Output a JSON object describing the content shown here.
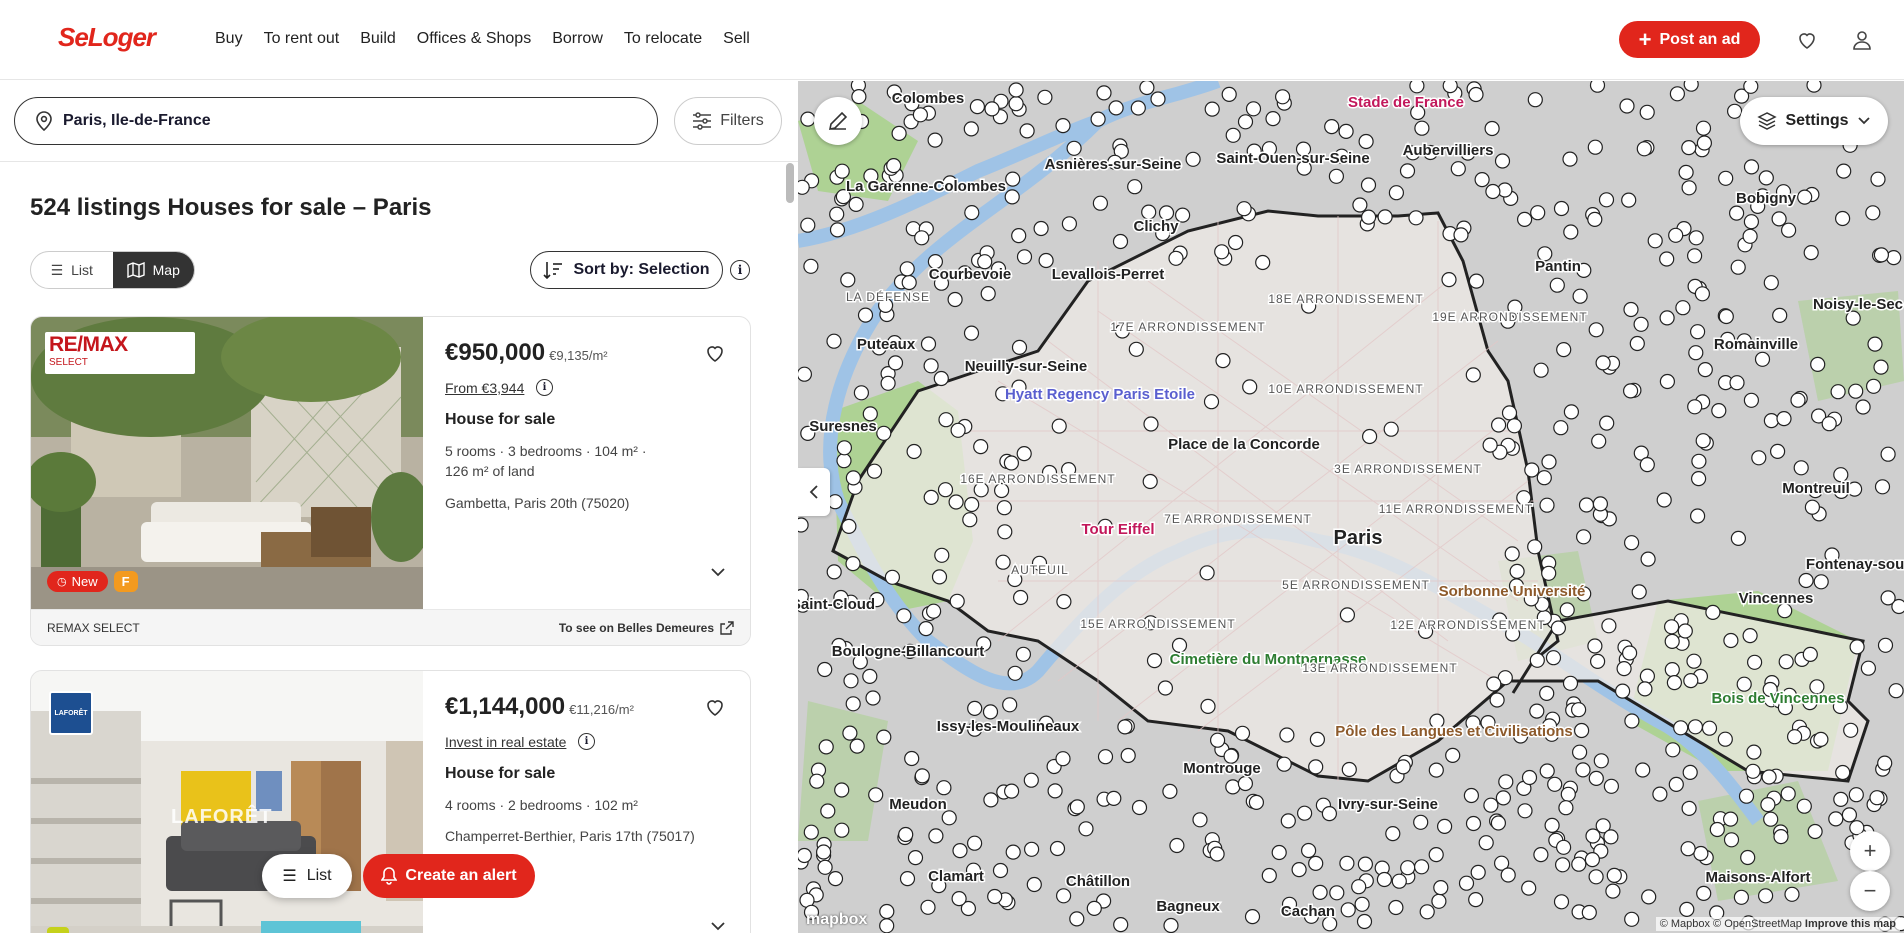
{
  "header": {
    "logo": "SeLoger",
    "nav": [
      "Buy",
      "To rent out",
      "Build",
      "Offices & Shops",
      "Borrow",
      "To relocate",
      "Sell"
    ],
    "post_ad": "Post an ad"
  },
  "search": {
    "location": "Paris, Ile-de-France",
    "filters_label": "Filters"
  },
  "results": {
    "title": "524 listings Houses for sale – Paris",
    "view_list": "List",
    "view_map": "Map",
    "sort_label": "Sort by: Selection"
  },
  "listings": [
    {
      "agency_logo": "RE/MAX",
      "agency_logo_sub": "SELECT",
      "price": "€950,000",
      "price_m2": "€9,135/m²",
      "link": "From €3,944",
      "type": "House for sale",
      "specs_line1": "5 rooms · 3 bedrooms · 104 m² ·",
      "specs_line2": "126 m² of land",
      "location": "Gambetta, Paris 20th (75020)",
      "badge_new": "New",
      "badge_energy": "F",
      "agency": "REMAX SELECT",
      "external": "To see on Belles Demeures"
    },
    {
      "agency_logo": "LAFORÊT",
      "watermark": "LAFORÊT",
      "price": "€1,144,000",
      "price_m2": "€11,216/m²",
      "link": "Invest in real estate",
      "type": "House for sale",
      "specs_line1": "4 rooms · 2 bedrooms · 102 m²",
      "location": "Champerret-Berthier, Paris 17th (75017)"
    }
  ],
  "floating": {
    "list": "List",
    "alert": "Create an alert"
  },
  "map": {
    "settings": "Settings",
    "attribution": "© Mapbox © OpenStreetMap",
    "improve": "Improve this map",
    "logo": "mapbox",
    "labels": [
      {
        "t": "Stade de France",
        "c": "#c2185b"
      },
      {
        "t": "Aubervilliers"
      },
      {
        "t": "Saint-Ouen-sur-Seine"
      },
      {
        "t": "Colombes"
      },
      {
        "t": "La Garenne-Colombes"
      },
      {
        "t": "Asnières-sur-Seine"
      },
      {
        "t": "Clichy"
      },
      {
        "t": "Bobigny"
      },
      {
        "t": "Pantin"
      },
      {
        "t": "Courbevoie"
      },
      {
        "t": "Levallois-Perret"
      },
      {
        "t": "LA DÉFENSE"
      },
      {
        "t": "17E ARRONDISSEMENT"
      },
      {
        "t": "18E ARRONDISSEMENT"
      },
      {
        "t": "19E ARRONDISSEMENT"
      },
      {
        "t": "Puteaux"
      },
      {
        "t": "Neuilly-sur-Seine"
      },
      {
        "t": "Hyatt Regency Paris Etoile",
        "c": "#5a5fcf"
      },
      {
        "t": "10E ARRONDISSEMENT"
      },
      {
        "t": "Romainville"
      },
      {
        "t": "Noisy-le-Sec"
      },
      {
        "t": "Suresnes"
      },
      {
        "t": "Place de la Concorde"
      },
      {
        "t": "16E ARRONDISSEMENT"
      },
      {
        "t": "3E ARRONDISSEMENT"
      },
      {
        "t": "Montreuil"
      },
      {
        "t": "7E ARRONDISSEMENT"
      },
      {
        "t": "11E ARRONDISSEMENT"
      },
      {
        "t": "Tour Eiffel",
        "c": "#c2185b"
      },
      {
        "t": "Paris"
      },
      {
        "t": "AUTEUIL"
      },
      {
        "t": "5E ARRONDISSEMENT"
      },
      {
        "t": "Sorbonne Université",
        "c": "#8d5a2b"
      },
      {
        "t": "Saint-Cloud"
      },
      {
        "t": "Vincennes"
      },
      {
        "t": "Fontenay-sous-Bois"
      },
      {
        "t": "15E ARRONDISSEMENT"
      },
      {
        "t": "12E ARRONDISSEMENT"
      },
      {
        "t": "Boulogne-Billancourt"
      },
      {
        "t": "Cimetière du Montparnasse",
        "c": "#2e7d32"
      },
      {
        "t": "13E ARRONDISSEMENT"
      },
      {
        "t": "Bois de Vincennes",
        "c": "#2e7d32"
      },
      {
        "t": "Issy-les-Moulineaux"
      },
      {
        "t": "Pôle des Langues et Civilisations",
        "c": "#8d5a2b"
      },
      {
        "t": "Montrouge"
      },
      {
        "t": "Ivry-sur-Seine"
      },
      {
        "t": "Meudon"
      },
      {
        "t": "Maisons-Alfort"
      },
      {
        "t": "Clamart"
      },
      {
        "t": "Châtillon"
      },
      {
        "t": "Bagneux"
      },
      {
        "t": "Cachan"
      }
    ]
  }
}
